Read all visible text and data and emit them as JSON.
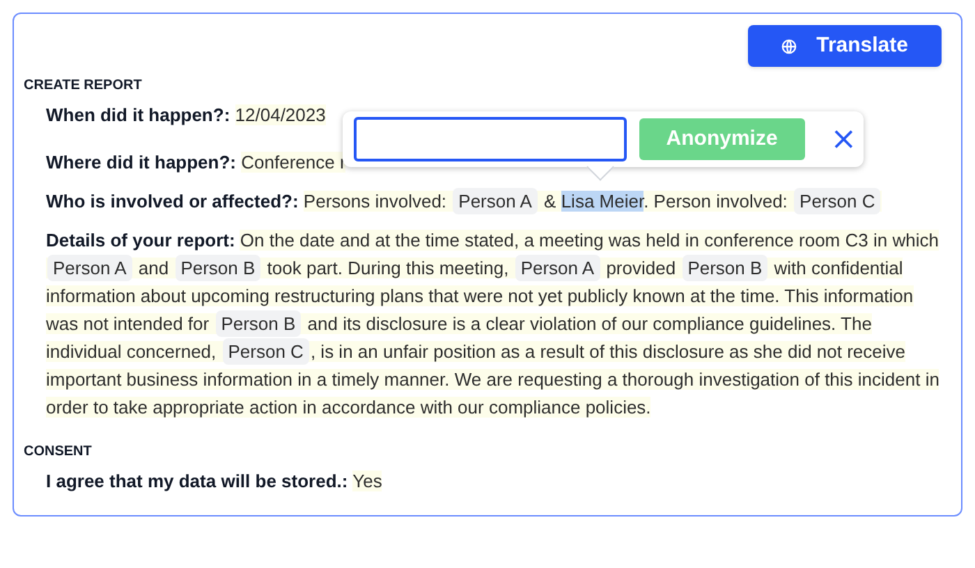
{
  "toolbar": {
    "translate_button": "Translate"
  },
  "sections": [
    {
      "title": "CREATE REPORT",
      "fields": [
        {
          "label": "When did it happen?:",
          "segments": [
            {
              "kind": "text",
              "text": "12/04/2023"
            }
          ]
        },
        {
          "label": "Where did it happen?:",
          "segments": [
            {
              "kind": "text",
              "text": "Conference r"
            }
          ]
        },
        {
          "label": "Who is involved or affected?:",
          "segments": [
            {
              "kind": "text",
              "text": "Persons involved: "
            },
            {
              "kind": "tag",
              "text": "Person A"
            },
            {
              "kind": "text",
              "text": " & "
            },
            {
              "kind": "highlight",
              "text": "Lisa Meier"
            },
            {
              "kind": "text",
              "text": ". Person involved: "
            },
            {
              "kind": "tag",
              "text": "Person C"
            }
          ]
        },
        {
          "label": "Details of your report:",
          "segments": [
            {
              "kind": "text",
              "text": "On the date and at the time stated, a meeting was held in conference room C3 in which "
            },
            {
              "kind": "tag",
              "text": "Person A"
            },
            {
              "kind": "text",
              "text": " and "
            },
            {
              "kind": "tag",
              "text": "Person B"
            },
            {
              "kind": "text",
              "text": " took part. During this meeting, "
            },
            {
              "kind": "tag",
              "text": "Person A"
            },
            {
              "kind": "text",
              "text": " provided "
            },
            {
              "kind": "tag",
              "text": "Person B"
            },
            {
              "kind": "text",
              "text": " with confidential information about upcoming restructuring plans that were not yet publicly known at the time. This information was not intended for "
            },
            {
              "kind": "tag",
              "text": "Person B"
            },
            {
              "kind": "text",
              "text": " and its disclosure is a clear violation of our compliance guidelines. The individual concerned, "
            },
            {
              "kind": "tag",
              "text": "Person C"
            },
            {
              "kind": "text",
              "text": ", is in an unfair position as a result of this disclosure as she did not receive important business information in a timely manner. We are requesting a thorough investigation of this incident in order to take appropriate action in accordance with our compliance policies."
            }
          ]
        }
      ]
    },
    {
      "title": "CONSENT",
      "fields": [
        {
          "label": "I agree that my data will be stored.:",
          "segments": [
            {
              "kind": "text",
              "text": "Yes"
            }
          ]
        }
      ]
    }
  ],
  "popover": {
    "button": "Anonymize",
    "disabled": true
  }
}
